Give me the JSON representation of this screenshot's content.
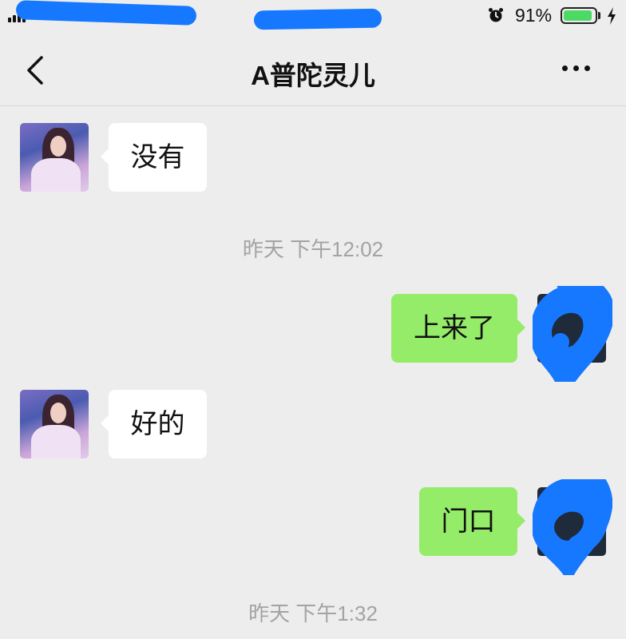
{
  "status_bar": {
    "battery_percent": "91%",
    "battery_level": 0.91,
    "icons": [
      "signal-icon",
      "alarm-clock-icon",
      "battery-icon",
      "charging-bolt-icon"
    ]
  },
  "nav": {
    "title": "A普陀灵儿",
    "back_icon": "chevron-left-icon",
    "more_icon": "more-dots-icon"
  },
  "messages": [
    {
      "direction": "incoming",
      "text": "没有"
    },
    {
      "type": "timestamp",
      "text": "昨天 下午12:02"
    },
    {
      "direction": "outgoing",
      "text": "上来了"
    },
    {
      "direction": "incoming",
      "text": "好的"
    },
    {
      "direction": "outgoing",
      "text": "门口"
    },
    {
      "type": "timestamp",
      "text": "昨天 下午1:32"
    }
  ],
  "colors": {
    "background": "#ededed",
    "incoming_bubble": "#ffffff",
    "outgoing_bubble": "#95ec69",
    "redaction_scribble": "#1677ff",
    "timestamp_text": "#a3a3a3"
  }
}
